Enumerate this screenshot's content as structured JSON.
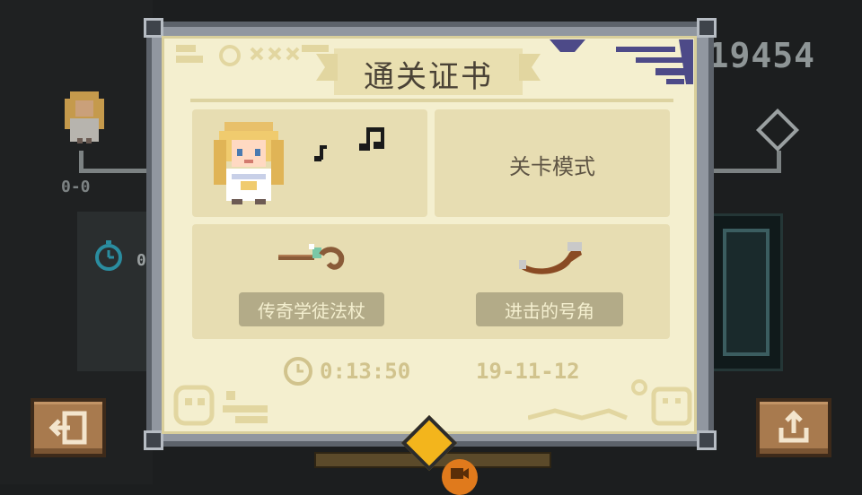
{
  "hud": {
    "score": "19454",
    "record": "0-0",
    "stopwatch_digit": "0"
  },
  "certificate": {
    "title": "通关证书",
    "mode": "关卡模式",
    "items": [
      {
        "name": "传奇学徒法杖",
        "icon": "staff-icon"
      },
      {
        "name": "进击的号角",
        "icon": "horn-icon"
      }
    ],
    "time": "0:13:50",
    "date": "19-11-12"
  },
  "colors": {
    "paper": "#f4efcf",
    "panel": "#e7ddb2",
    "label_bg": "#b3ab88",
    "frame": "#9197a0",
    "button_brown": "#a87a4e",
    "gem": "#f3b51c"
  }
}
